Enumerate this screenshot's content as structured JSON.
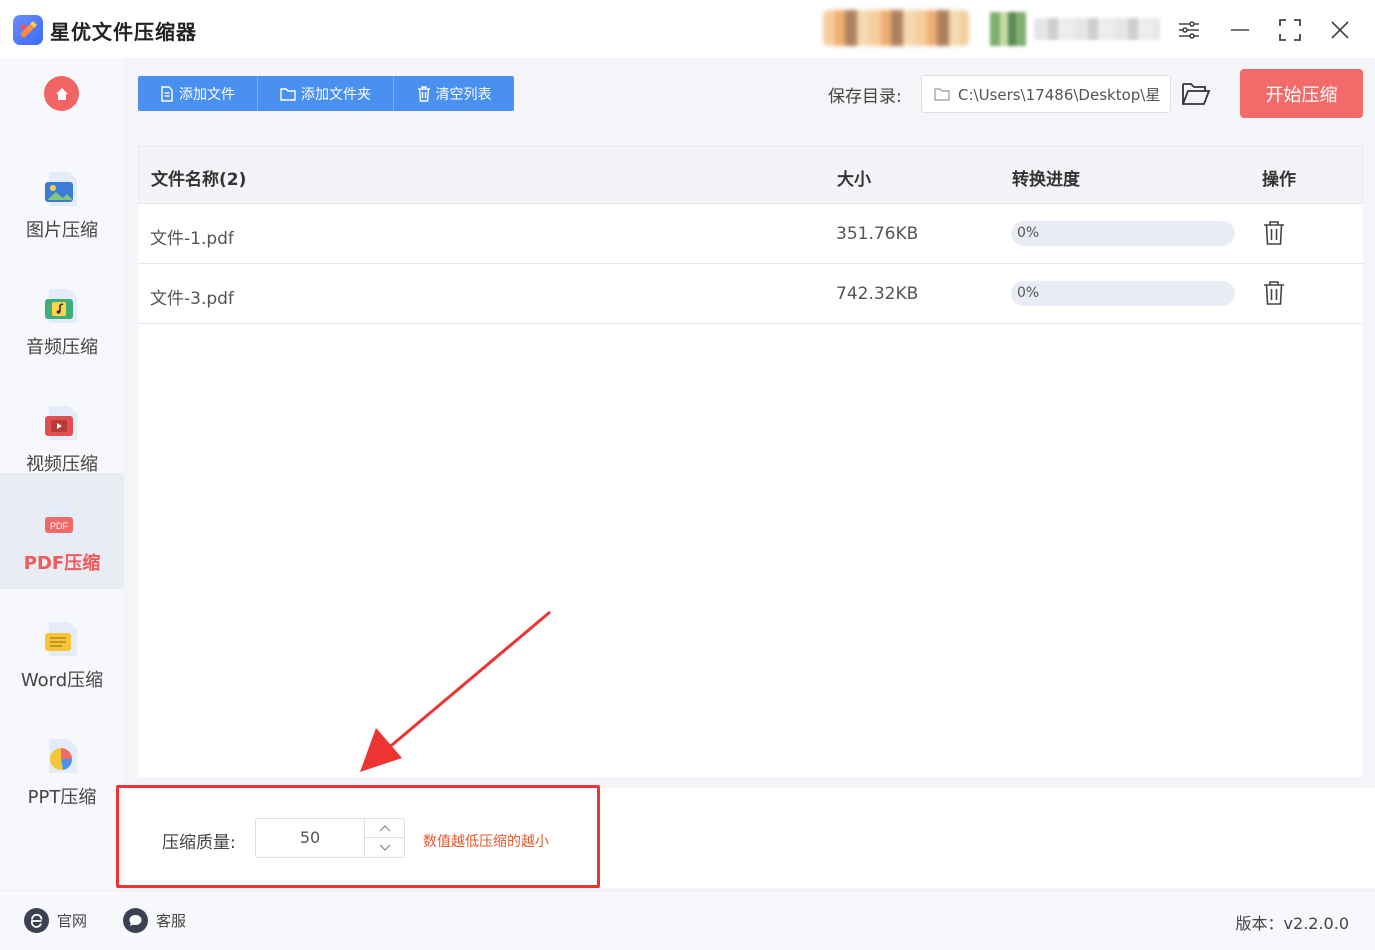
{
  "app": {
    "title": "星优文件压缩器",
    "accent": "#f26b6b",
    "blue": "#4a90f0"
  },
  "window_controls": [
    "settings-icon",
    "minimize-icon",
    "maximize-icon",
    "close-icon"
  ],
  "sidebar": {
    "items": [
      {
        "label": "图片压缩",
        "icon": "image-icon"
      },
      {
        "label": "音频压缩",
        "icon": "audio-icon"
      },
      {
        "label": "视频压缩",
        "icon": "video-icon"
      },
      {
        "label": "PDF压缩",
        "icon": "pdf-icon",
        "active": true
      },
      {
        "label": "Word压缩",
        "icon": "word-icon"
      },
      {
        "label": "PPT压缩",
        "icon": "ppt-icon"
      }
    ]
  },
  "toolbar": {
    "add_file": "添加文件",
    "add_folder": "添加文件夹",
    "clear_list": "清空列表",
    "save_label": "保存目录:",
    "save_path": "C:\\Users\\17486\\Desktop\\星",
    "start": "开始压缩"
  },
  "table": {
    "headers": {
      "name": "文件名称(2)",
      "size": "大小",
      "progress": "转换进度",
      "action": "操作"
    },
    "rows": [
      {
        "name": "文件-1.pdf",
        "size": "351.76KB",
        "progress": "0%",
        "progress_value": 0
      },
      {
        "name": "文件-3.pdf",
        "size": "742.32KB",
        "progress": "0%",
        "progress_value": 0
      }
    ]
  },
  "settings": {
    "quality_label": "压缩质量:",
    "quality_value": "50",
    "hint": "数值越低压缩的越小"
  },
  "footer": {
    "website": "官网",
    "support": "客服",
    "version": "版本：v2.2.0.0"
  }
}
